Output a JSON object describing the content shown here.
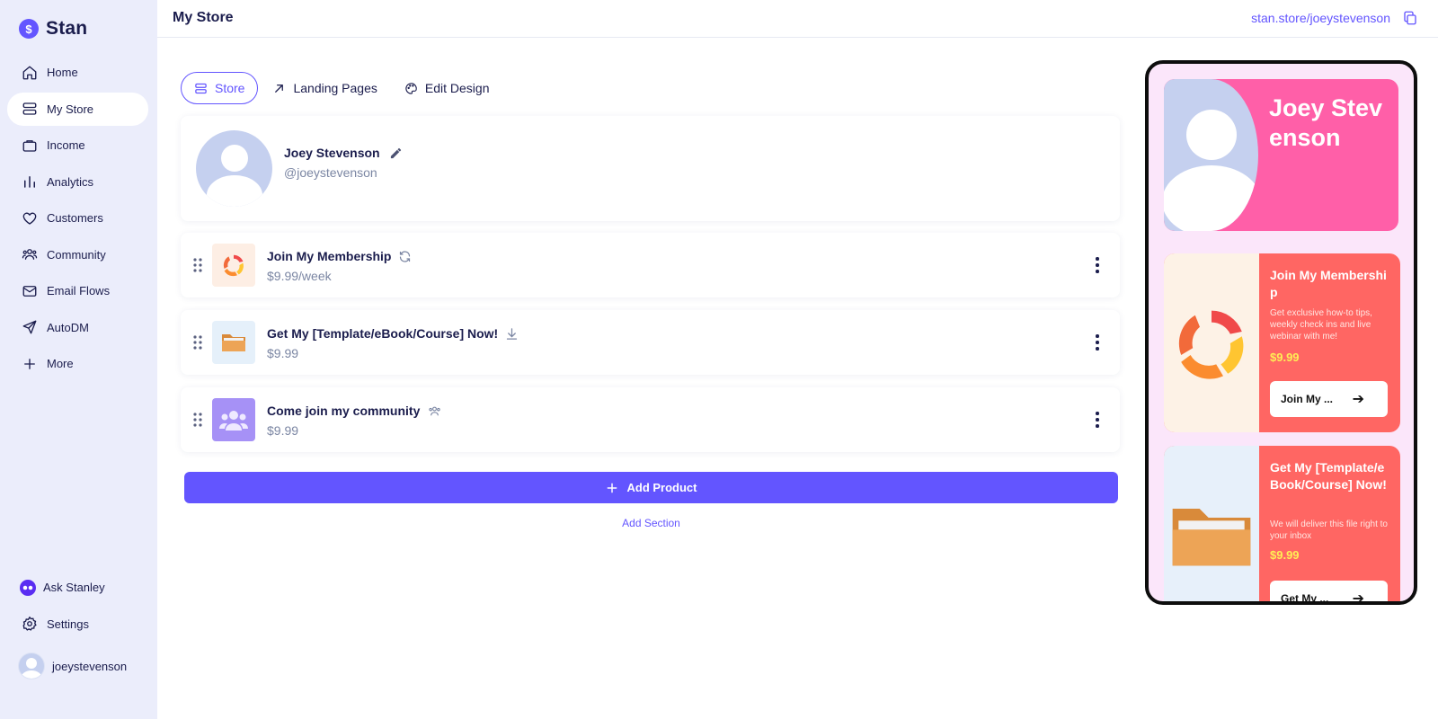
{
  "brand": {
    "name": "Stan",
    "logo_glyph": "$"
  },
  "sidebar": {
    "items": [
      {
        "label": "Home",
        "icon": "home-icon"
      },
      {
        "label": "My Store",
        "icon": "store-icon",
        "active": true
      },
      {
        "label": "Income",
        "icon": "wallet-icon"
      },
      {
        "label": "Analytics",
        "icon": "bar-chart-icon"
      },
      {
        "label": "Customers",
        "icon": "heart-icon"
      },
      {
        "label": "Community",
        "icon": "users-icon"
      },
      {
        "label": "Email Flows",
        "icon": "mail-icon"
      },
      {
        "label": "AutoDM",
        "icon": "send-icon"
      },
      {
        "label": "More",
        "icon": "plus-icon"
      }
    ],
    "bottom": [
      {
        "label": "Ask Stanley",
        "icon": "stanley-icon"
      },
      {
        "label": "Settings",
        "icon": "gear-icon"
      }
    ],
    "user": {
      "username": "joeystevenson"
    }
  },
  "header": {
    "title": "My Store",
    "store_url": "stan.store/joeystevenson"
  },
  "tabs": [
    {
      "label": "Store",
      "active": true
    },
    {
      "label": "Landing Pages"
    },
    {
      "label": "Edit Design"
    }
  ],
  "profile": {
    "name": "Joey Stevenson",
    "handle": "@joeystevenson"
  },
  "products": [
    {
      "title": "Join My Membership",
      "price": "$9.99/week",
      "badge_icon": "recurring-icon"
    },
    {
      "title": "Get My [Template/eBook/Course] Now!",
      "price": "$9.99",
      "badge_icon": "download-icon"
    },
    {
      "title": "Come join my community",
      "price": "$9.99",
      "badge_icon": "community-icon"
    }
  ],
  "actions": {
    "add_product": "Add Product",
    "add_section": "Add Section"
  },
  "preview": {
    "hero_name": "Joey Stevenson",
    "cards": [
      {
        "title": "Join My Membership",
        "description": "Get exclusive how-to tips, weekly check ins and live webinar with me!",
        "price": "$9.99",
        "button": "Join My ..."
      },
      {
        "title": "Get My [Template/eBook/Course] Now!",
        "description": "We will deliver this file right to your inbox",
        "price": "$9.99",
        "button": "Get My ..."
      }
    ]
  },
  "colors": {
    "accent": "#6355ff",
    "sidebar_bg": "#ebedfb",
    "hero_pink": "#ff5fa8",
    "card_coral": "#ff6663",
    "price_yellow": "#ffee55"
  }
}
